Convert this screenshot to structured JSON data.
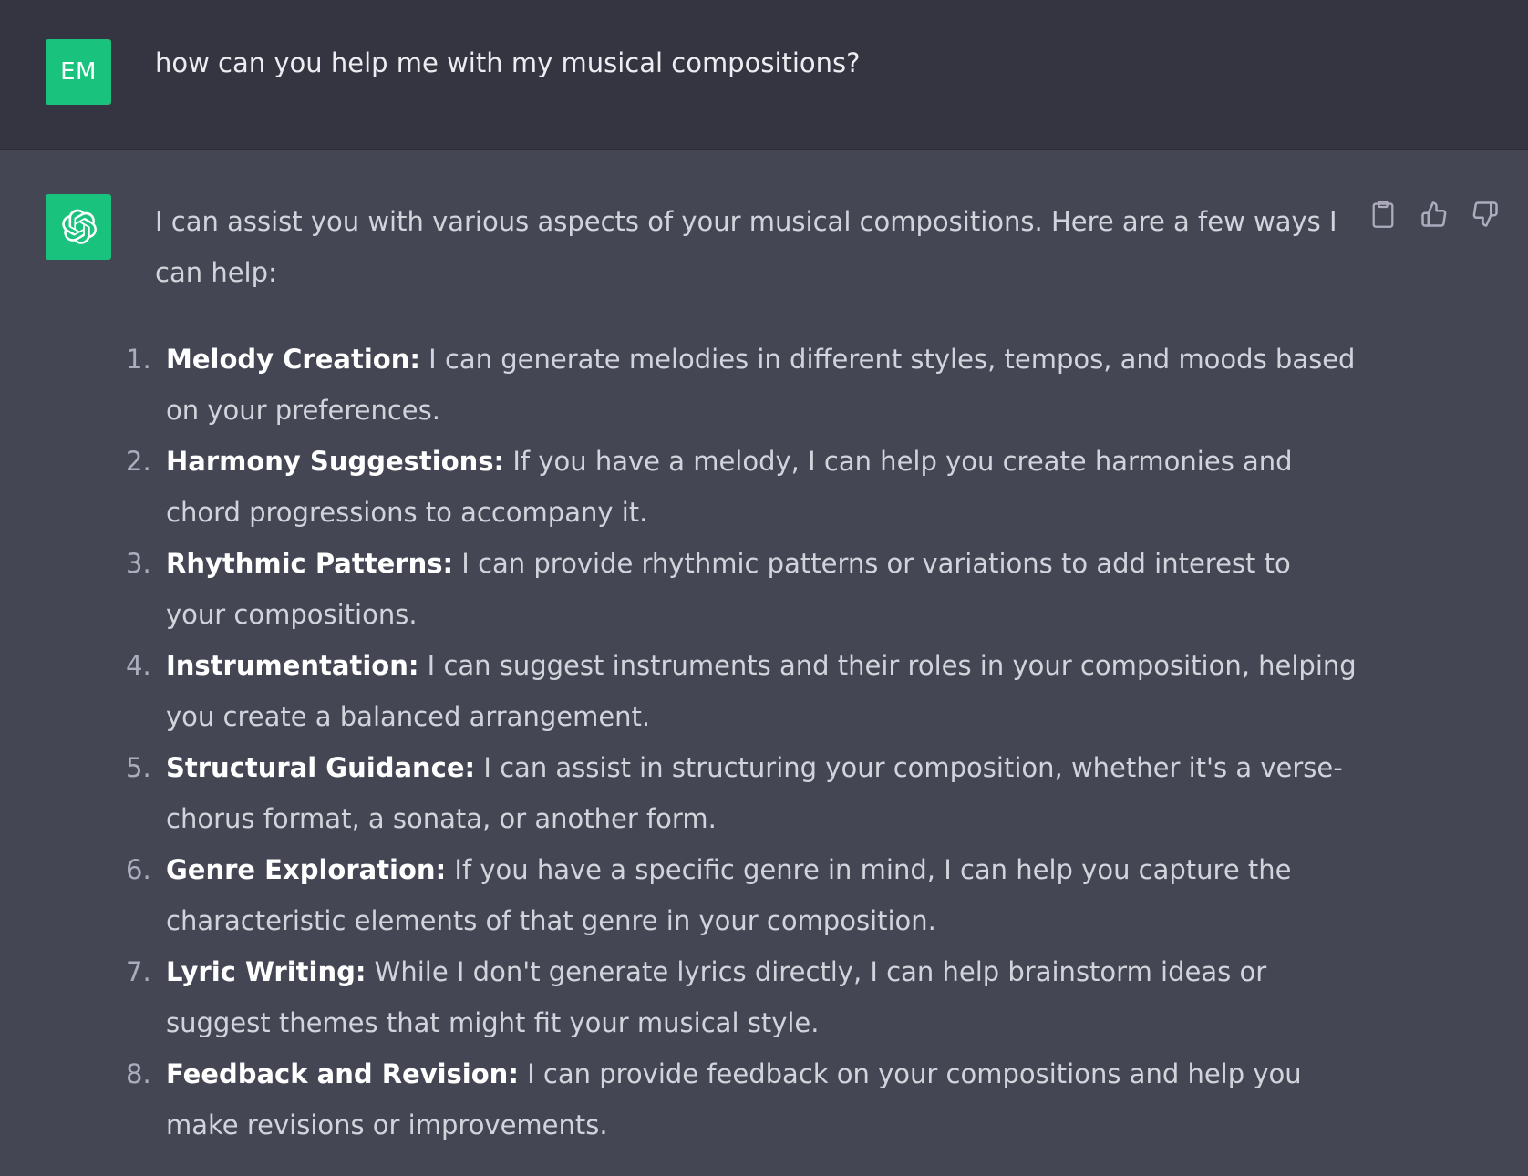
{
  "user_message": {
    "avatar_initials": "EM",
    "text": "how can you help me with my musical compositions?"
  },
  "assistant_message": {
    "avatar_icon": "openai-logo-icon",
    "intro": "I can assist you with various aspects of your musical compositions. Here are a few ways I can help:",
    "items": [
      {
        "num": "1.",
        "title": "Melody Creation:",
        "text": " I can generate melodies in different styles, tempos, and moods based on your preferences."
      },
      {
        "num": "2.",
        "title": "Harmony Suggestions:",
        "text": " If you have a melody, I can help you create harmonies and chord progressions to accompany it."
      },
      {
        "num": "3.",
        "title": "Rhythmic Patterns:",
        "text": " I can provide rhythmic patterns or variations to add interest to your compositions."
      },
      {
        "num": "4.",
        "title": "Instrumentation:",
        "text": " I can suggest instruments and their roles in your composition, helping you create a balanced arrangement."
      },
      {
        "num": "5.",
        "title": "Structural Guidance:",
        "text": " I can assist in structuring your composition, whether it's a verse-chorus format, a sonata, or another form."
      },
      {
        "num": "6.",
        "title": "Genre Exploration:",
        "text": " If you have a specific genre in mind, I can help you capture the characteristic elements of that genre in your composition."
      },
      {
        "num": "7.",
        "title": "Lyric Writing:",
        "text": " While I don't generate lyrics directly, I can help brainstorm ideas or suggest themes that might fit your musical style."
      },
      {
        "num": "8.",
        "title": "Feedback and Revision:",
        "text": " I can provide feedback on your compositions and help you make revisions or improvements."
      }
    ],
    "actions": [
      "clipboard-icon",
      "thumbs-up-icon",
      "thumbs-down-icon"
    ]
  },
  "colors": {
    "user_bg": "#343541",
    "assistant_bg": "#444654",
    "avatar_green": "#19c37d",
    "text": "#d1d5db"
  }
}
